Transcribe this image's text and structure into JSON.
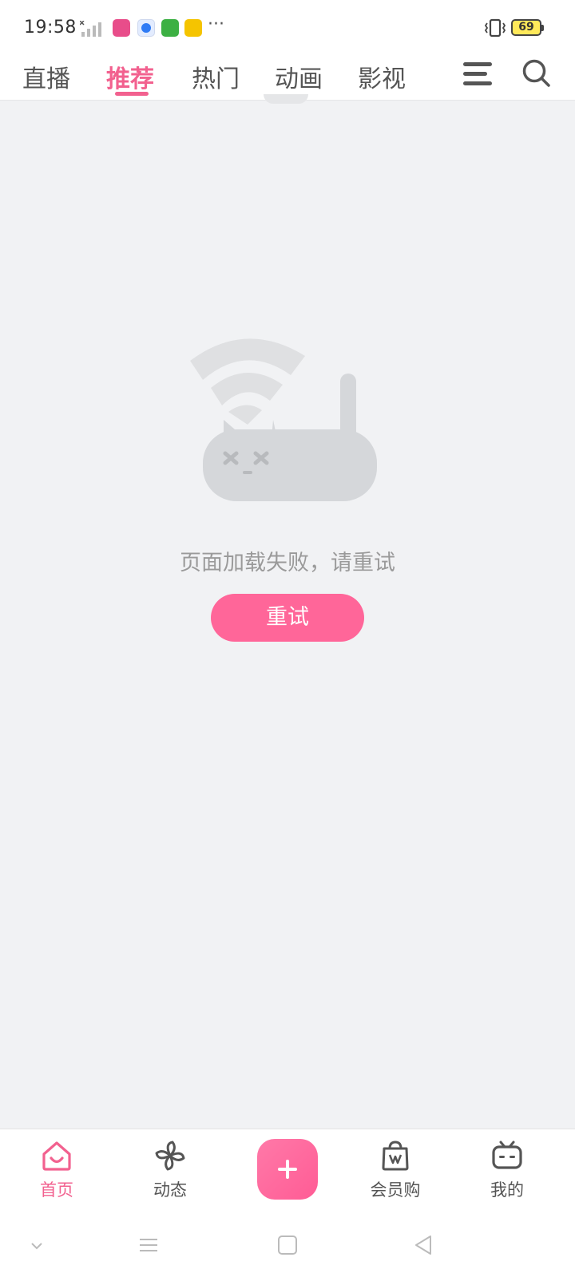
{
  "status_bar": {
    "time": "19:58",
    "battery_level": "69",
    "notification_icons": [
      "bilibili-app-icon",
      "browser-app-icon",
      "shopping-app-icon",
      "vip-app-icon"
    ],
    "more": "···"
  },
  "top_tabs": [
    {
      "label": "直播",
      "active": false
    },
    {
      "label": "推荐",
      "active": true
    },
    {
      "label": "热门",
      "active": false
    },
    {
      "label": "动画",
      "active": false
    },
    {
      "label": "影视",
      "active": false
    }
  ],
  "error": {
    "message": "页面加载失败，请重试",
    "retry_label": "重试"
  },
  "bottom_tabs": [
    {
      "label": "首页",
      "icon": "home-icon",
      "active": true
    },
    {
      "label": "动态",
      "icon": "pinwheel-icon",
      "active": false
    },
    {
      "label": "会员购",
      "icon": "shopping-bag-icon",
      "active": false
    },
    {
      "label": "我的",
      "icon": "tv-face-icon",
      "active": false
    }
  ],
  "colors": {
    "accent": "#f2618f",
    "retry_button": "#ff6699",
    "background": "#f1f2f4"
  }
}
